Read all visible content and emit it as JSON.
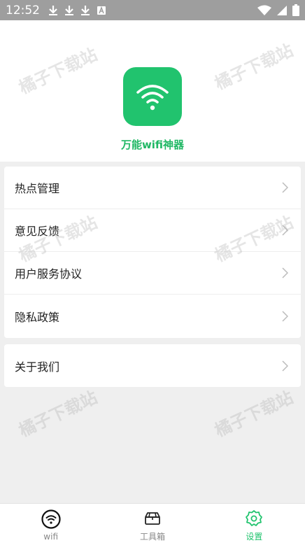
{
  "status_bar": {
    "time": "12:52"
  },
  "header": {
    "app_name": "万能wifi神器"
  },
  "menu": {
    "group1": [
      {
        "label": "热点管理"
      },
      {
        "label": "意见反馈"
      },
      {
        "label": "用户服务协议"
      },
      {
        "label": "隐私政策"
      }
    ],
    "group2": [
      {
        "label": "关于我们"
      }
    ]
  },
  "bottom_nav": {
    "tabs": [
      {
        "label": "wifi",
        "icon": "wifi-icon"
      },
      {
        "label": "工具箱",
        "icon": "toolbox-icon"
      },
      {
        "label": "设置",
        "icon": "gear-icon",
        "active": true
      }
    ]
  },
  "watermark": {
    "text": "橘子下载站"
  },
  "colors": {
    "accent": "#21c36e",
    "status_bar": "#9e9e9e"
  }
}
